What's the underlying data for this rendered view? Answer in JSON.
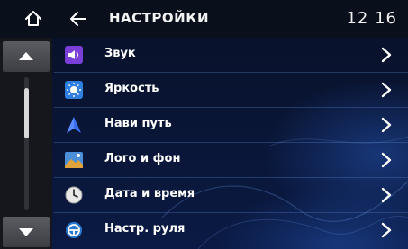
{
  "header": {
    "title": "НАСТРОЙКИ",
    "clock": "12 16"
  },
  "menu": {
    "items": [
      {
        "label": "Звук",
        "icon": "speaker-icon",
        "color": "#7a3fd6"
      },
      {
        "label": "Яркость",
        "icon": "brightness-icon",
        "color": "#2f7fe0"
      },
      {
        "label": "Нави путь",
        "icon": "navigation-arrow-icon",
        "color": "#3a6ff0"
      },
      {
        "label": "Лого и фон",
        "icon": "picture-icon",
        "color": "#4a8fd8"
      },
      {
        "label": "Дата и время",
        "icon": "clock-icon",
        "color": "#e8e8e8"
      },
      {
        "label": "Настр. руля",
        "icon": "steering-wheel-icon",
        "color": "#2a78d0"
      }
    ]
  },
  "scroll": {
    "position_fraction": 0.0
  }
}
